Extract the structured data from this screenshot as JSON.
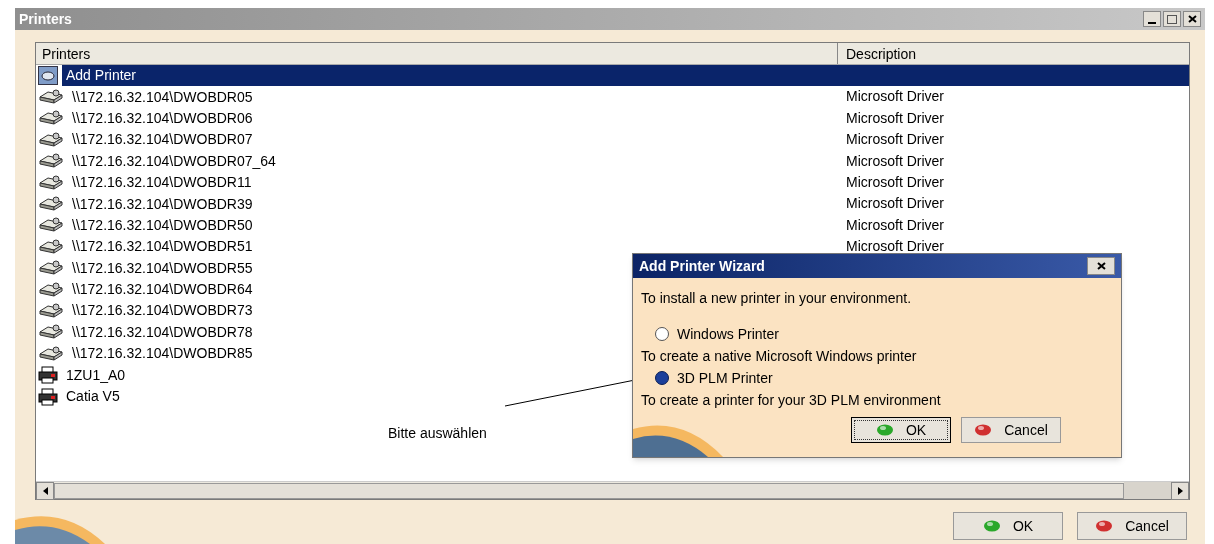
{
  "window": {
    "title": "Printers"
  },
  "table": {
    "columns": [
      "Printers",
      "Description"
    ],
    "rows": [
      {
        "kind": "add",
        "name": "Add Printer",
        "selected": true
      },
      {
        "kind": "network",
        "name": "\\\\172.16.32.104\\DWOBDR05",
        "description": "Microsoft Driver",
        "selected": false
      },
      {
        "kind": "network",
        "name": "\\\\172.16.32.104\\DWOBDR06",
        "description": "Microsoft Driver",
        "selected": false
      },
      {
        "kind": "network",
        "name": "\\\\172.16.32.104\\DWOBDR07",
        "description": "Microsoft Driver",
        "selected": false
      },
      {
        "kind": "network",
        "name": "\\\\172.16.32.104\\DWOBDR07_64",
        "description": "Microsoft Driver",
        "selected": false
      },
      {
        "kind": "network",
        "name": "\\\\172.16.32.104\\DWOBDR11",
        "description": "Microsoft Driver",
        "selected": false
      },
      {
        "kind": "network",
        "name": "\\\\172.16.32.104\\DWOBDR39",
        "description": "Microsoft Driver",
        "selected": false
      },
      {
        "kind": "network",
        "name": "\\\\172.16.32.104\\DWOBDR50",
        "description": "Microsoft Driver",
        "selected": false
      },
      {
        "kind": "network",
        "name": "\\\\172.16.32.104\\DWOBDR51",
        "description": "Microsoft Driver",
        "selected": false
      },
      {
        "kind": "network",
        "name": "\\\\172.16.32.104\\DWOBDR55",
        "selected": false
      },
      {
        "kind": "network",
        "name": "\\\\172.16.32.104\\DWOBDR64",
        "selected": false
      },
      {
        "kind": "network",
        "name": "\\\\172.16.32.104\\DWOBDR73",
        "selected": false
      },
      {
        "kind": "network",
        "name": "\\\\172.16.32.104\\DWOBDR78",
        "selected": false
      },
      {
        "kind": "network",
        "name": "\\\\172.16.32.104\\DWOBDR85",
        "selected": false
      },
      {
        "kind": "local",
        "name": "1ZU1_A0",
        "selected": false
      },
      {
        "kind": "local",
        "name": "Catia V5",
        "selected": false
      }
    ]
  },
  "annotation": {
    "text": "Bitte auswählen"
  },
  "buttons": [
    "OK",
    "Cancel"
  ],
  "wizard": {
    "title": "Add Printer Wizard",
    "intro": "To install a new printer in your environment.",
    "options": [
      {
        "label": "Windows Printer",
        "description": "To create a native Microsoft Windows printer",
        "selected": false
      },
      {
        "label": "3D PLM Printer",
        "description": "To create a printer for your 3D PLM environment",
        "selected": true
      }
    ],
    "buttons": [
      "OK",
      "Cancel"
    ]
  }
}
